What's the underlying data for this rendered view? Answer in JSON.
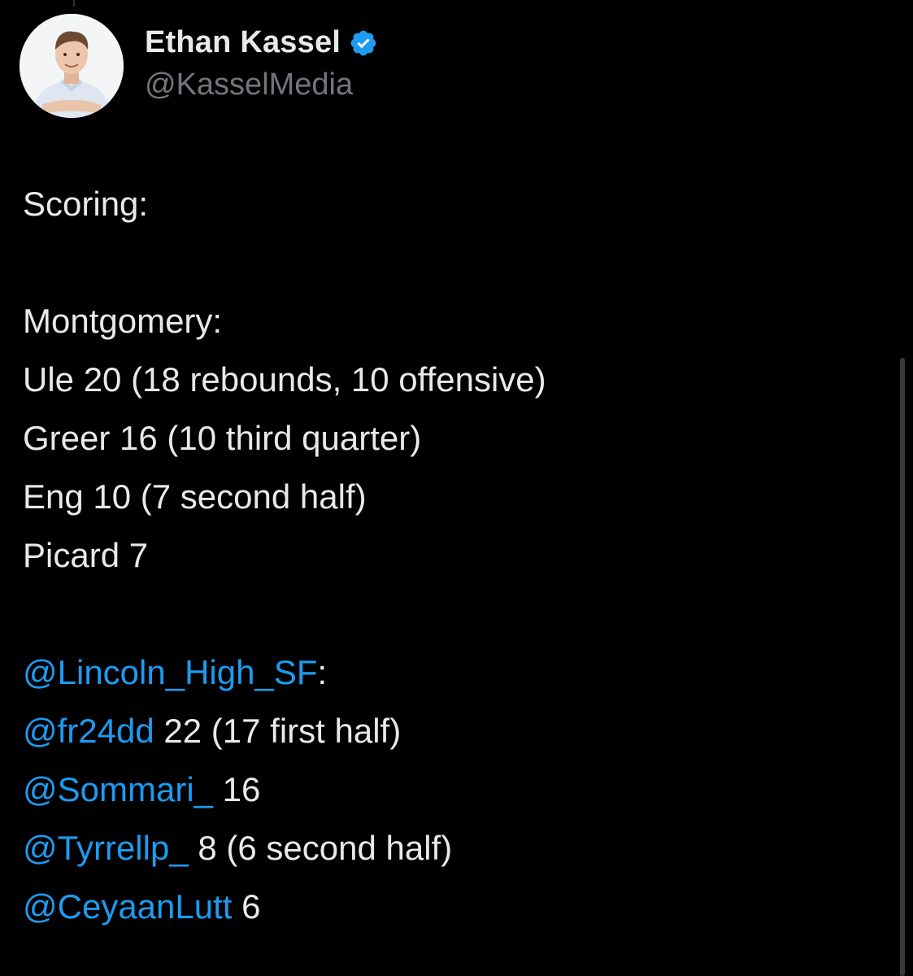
{
  "author": {
    "display_name": "Ethan Kassel",
    "handle": "@KasselMedia",
    "verified": true,
    "avatar_icon": "profile-photo-avatar",
    "verified_icon": "verified-badge-icon",
    "verified_color": "#1d9bf0"
  },
  "tweet": {
    "scoring_label": "Scoring:",
    "team1": {
      "name": "Montgomery:",
      "players": [
        {
          "text": "Ule 20 (18 rebounds, 10 offensive)"
        },
        {
          "text": "Greer 16 (10 third quarter)"
        },
        {
          "text": "Eng 10 (7 second half)"
        },
        {
          "text": "Picard 7"
        }
      ]
    },
    "team2": {
      "mention": "@Lincoln_High_SF",
      "suffix": ":",
      "players": [
        {
          "mention": "@fr24dd",
          "text": " 22 (17 first half)"
        },
        {
          "mention": "@Sommari_",
          "text": " 16"
        },
        {
          "mention": "@Tyrrellp_",
          "text": " 8 (6 second half)"
        },
        {
          "mention": "@CeyaanLutt",
          "text": " 6"
        }
      ]
    }
  },
  "colors": {
    "background": "#000000",
    "text": "#e7e9ea",
    "secondary_text": "#71767b",
    "link": "#1d9bf0"
  }
}
